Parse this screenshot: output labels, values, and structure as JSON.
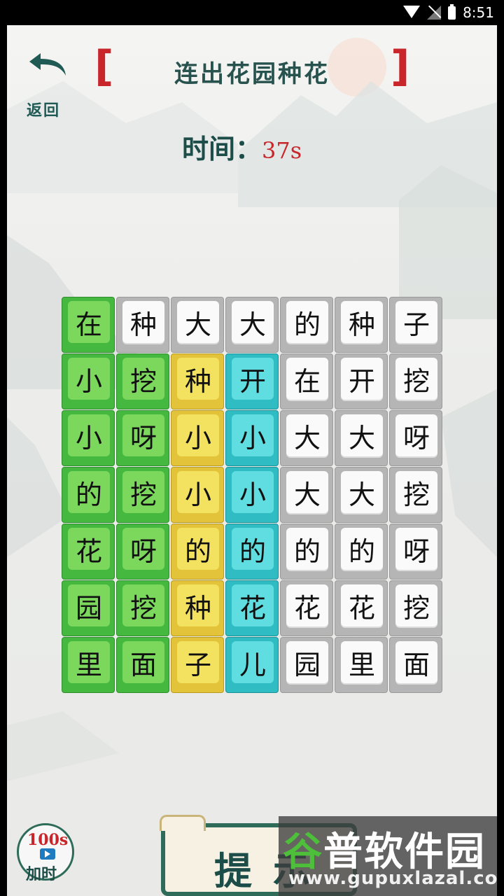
{
  "status_bar": {
    "time": "8:51"
  },
  "header": {
    "back_label": "返回",
    "title": "连出花园种花",
    "timer_label": "时间：",
    "timer_value": "37s"
  },
  "colors": {
    "green": "#45b840",
    "yellow": "#e2c33a",
    "cyan": "#2fbcc2",
    "gray": "#b5b5b5",
    "accent_red": "#c8262a"
  },
  "board": {
    "columns": [
      {
        "color": "green",
        "chars": [
          "在",
          "小",
          "小",
          "的",
          "花",
          "园",
          "里"
        ]
      },
      {
        "color": "mixed",
        "chars": [
          "种",
          "挖",
          "呀",
          "挖",
          "呀",
          "挖",
          "面"
        ],
        "colors": [
          "gray",
          "green",
          "green",
          "green",
          "green",
          "green",
          "green"
        ]
      },
      {
        "color": "mixed",
        "chars": [
          "大",
          "种",
          "小",
          "小",
          "的",
          "种",
          "子"
        ],
        "colors": [
          "gray",
          "yellow",
          "yellow",
          "yellow",
          "yellow",
          "yellow",
          "yellow"
        ]
      },
      {
        "color": "mixed",
        "chars": [
          "大",
          "开",
          "小",
          "小",
          "的",
          "花",
          "儿"
        ],
        "colors": [
          "gray",
          "cyan",
          "cyan",
          "cyan",
          "cyan",
          "cyan",
          "cyan"
        ]
      },
      {
        "color": "gray",
        "chars": [
          "的",
          "在",
          "大",
          "大",
          "的",
          "花",
          "园"
        ]
      },
      {
        "color": "gray",
        "chars": [
          "种",
          "开",
          "大",
          "大",
          "的",
          "花",
          "里"
        ]
      },
      {
        "color": "gray",
        "chars": [
          "子",
          "挖",
          "呀",
          "挖",
          "呀",
          "挖",
          "面"
        ]
      }
    ]
  },
  "footer": {
    "add_time_count": "100s",
    "add_time_label": "加时",
    "hint_label": "提示",
    "add_time_icon": "video-camera-icon"
  },
  "watermark": {
    "name": "谷普软件园",
    "url": "www.gupuxlazal.com"
  }
}
